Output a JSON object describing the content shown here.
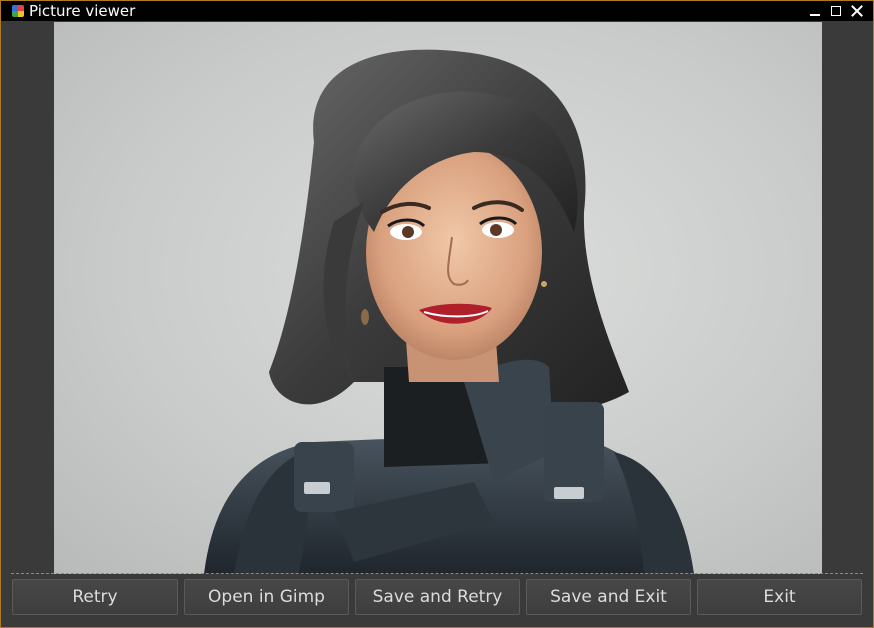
{
  "window": {
    "title": "Picture viewer",
    "border_color": "#b07a22",
    "background": "#3a3a3a"
  },
  "titlebar": {
    "icon": "picture-viewer-icon",
    "controls": [
      "minimize-icon",
      "maximize-icon",
      "close-icon"
    ]
  },
  "viewer": {
    "image_subject": "Stylized figurine of a smiling woman with dark grey hair in a dark armored suit against a light grey background"
  },
  "buttons": {
    "retry": "Retry",
    "open_in_gimp": "Open in Gimp",
    "save_and_retry": "Save and Retry",
    "save_and_exit": "Save and Exit",
    "exit": "Exit"
  }
}
